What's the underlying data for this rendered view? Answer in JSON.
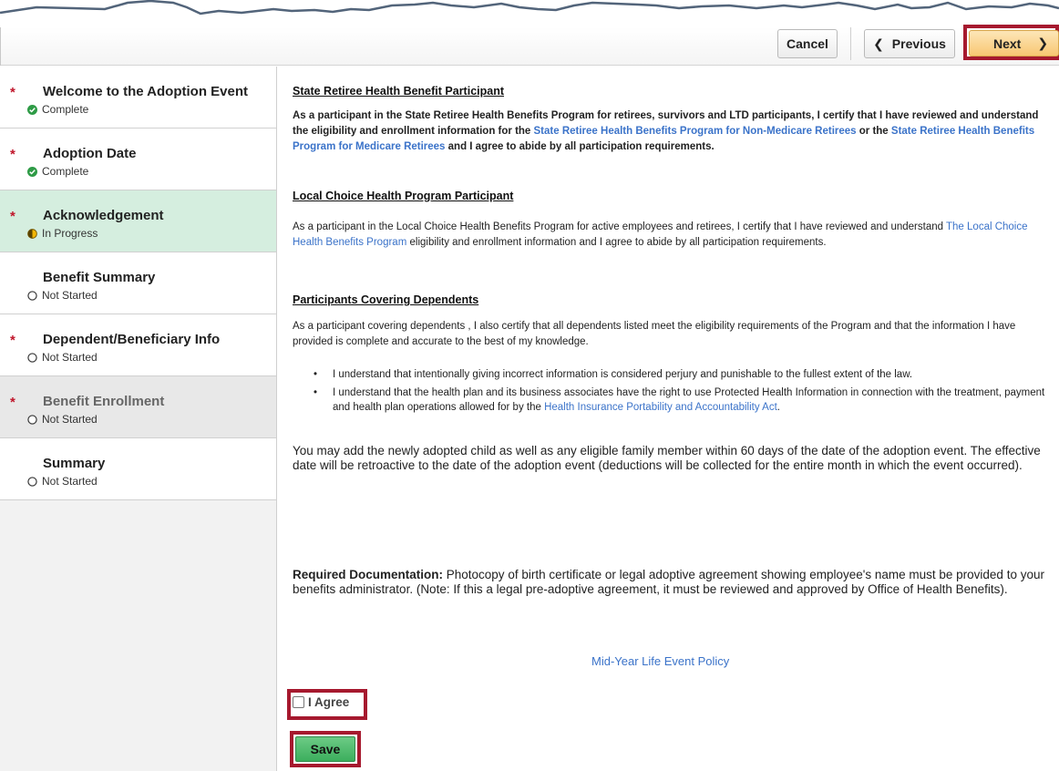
{
  "toolbar": {
    "cancel_label": "Cancel",
    "previous_label": "Previous",
    "next_label": "Next"
  },
  "steps": [
    {
      "title": "Welcome to the Adoption Event",
      "status": "Complete",
      "required": true,
      "state": "complete"
    },
    {
      "title": "Adoption Date",
      "status": "Complete",
      "required": true,
      "state": "complete"
    },
    {
      "title": "Acknowledgement",
      "status": "In Progress",
      "required": true,
      "state": "in-progress"
    },
    {
      "title": "Benefit Summary",
      "status": "Not Started",
      "required": false,
      "state": "not-started"
    },
    {
      "title": "Dependent/Beneficiary Info",
      "status": "Not Started",
      "required": true,
      "state": "not-started"
    },
    {
      "title": "Benefit Enrollment",
      "status": "Not Started",
      "required": true,
      "state": "not-started"
    },
    {
      "title": "Summary",
      "status": "Not Started",
      "required": false,
      "state": "not-started"
    }
  ],
  "required_marker": "*",
  "section1": {
    "title": "State Retiree Health Benefit Participant",
    "text_a": "As a participant in the State Retiree Health Benefits Program for retirees, survivors and LTD participants, I certify that I have reviewed and understand the eligibility and enrollment information for the ",
    "link_a": "State Retiree Health Benefits Program for Non-Medicare Retirees",
    "text_b": " or the ",
    "link_b": "State Retiree Health Benefits Program for Medicare Retirees",
    "text_c": " and I agree to abide by all participation requirements."
  },
  "section2": {
    "title": "Local Choice Health Program Participant",
    "text_a": "As a participant in the Local Choice Health Benefits Program for active employees and retirees, I certify that I have reviewed and understand ",
    "link_a": "The Local Choice Health Benefits Program",
    "text_b": " eligibility and enrollment information and I agree to abide by all participation requirements."
  },
  "section3": {
    "title": "Participants Covering Dependents",
    "text": "As a participant covering dependents , I also certify that all dependents listed meet the eligibility requirements of the Program and that the information I have provided is complete and accurate to the best of my knowledge.",
    "bullet1": "I understand that intentionally giving incorrect information is considered perjury and punishable to the fullest extent of the law.",
    "bullet2_a": "I understand that the health plan and its business associates have the right to use Protected Health Information in connection with the treatment, payment and health plan operations allowed for by the ",
    "bullet2_link": "Health Insurance Portability and Accountability Act",
    "bullet2_b": "."
  },
  "adoption_note": "You may add the newly adopted child as well as any eligible family member within 60 days of the date of the adoption event.  The effective date will be retroactive to the date of the adoption event (deductions will be collected for the entire month in which the event occurred).",
  "required_doc": {
    "label": "Required Documentation:",
    "text": " Photocopy of birth certificate or legal adoptive agreement showing employee's name must be provided to your benefits administrator. (Note: If this a legal pre-adoptive agreement, it must be reviewed and approved by Office of Health Benefits)."
  },
  "policy_link": "Mid-Year Life Event Policy",
  "agree": {
    "label": "I Agree",
    "checked": false
  },
  "save_label": "Save",
  "colors": {
    "highlight_border": "#a6192e",
    "link": "#3b73c9",
    "current_step_bg": "#d5eedf",
    "save_green": "#3cae5d",
    "next_orange": "#f8c772",
    "required_red": "#c0162b"
  },
  "icons": {
    "complete": "check-circle-icon",
    "in_progress": "half-circle-icon",
    "not_started": "empty-circle-icon",
    "previous": "chevron-left-icon",
    "next": "chevron-right-icon"
  }
}
